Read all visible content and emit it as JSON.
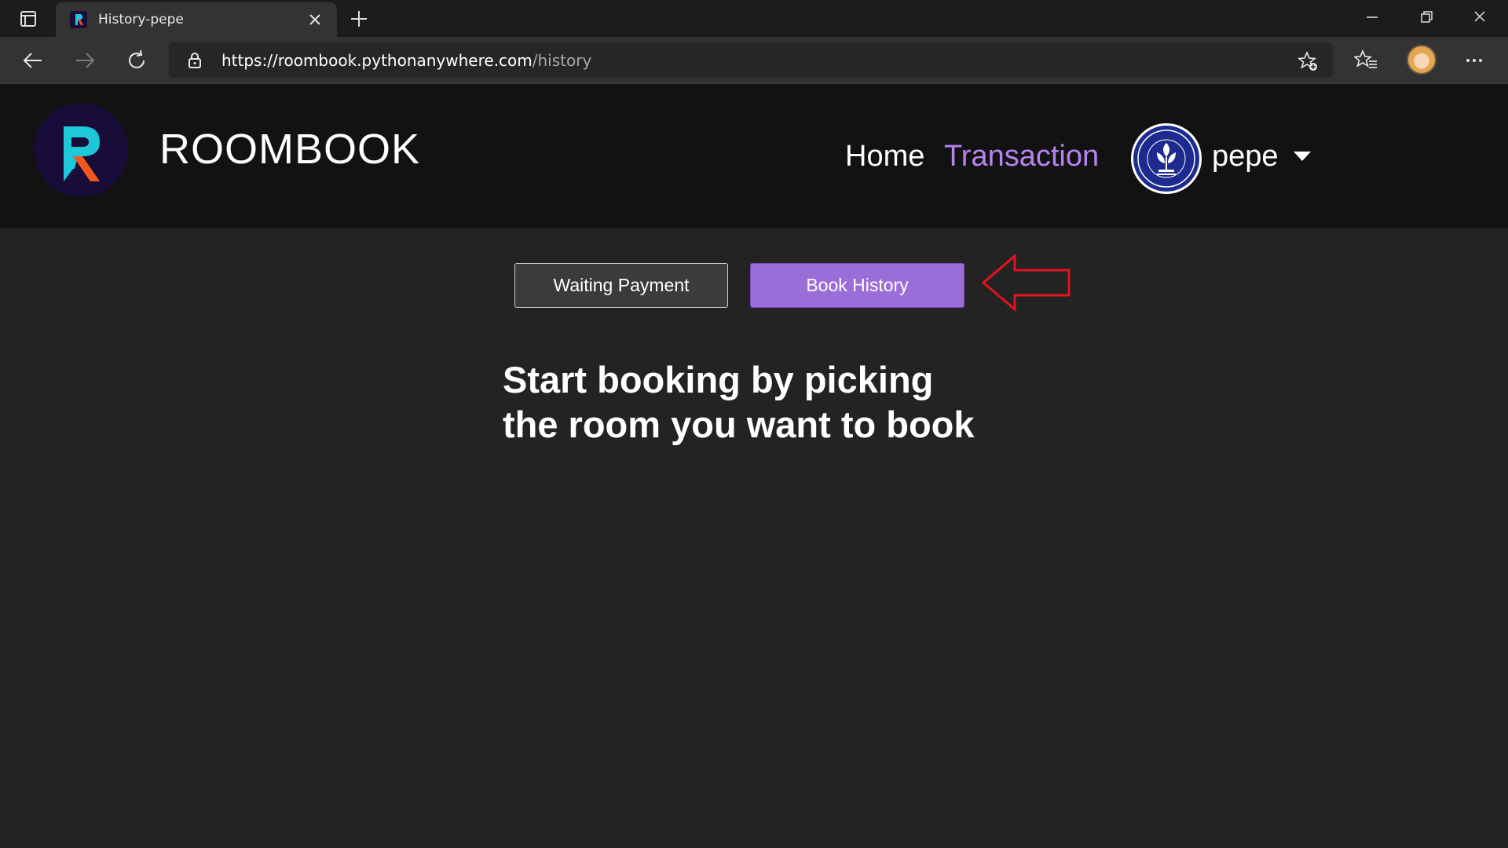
{
  "browser": {
    "tab_title": "History-pepe",
    "url_host": "https://roombook.pythonanywhere.com",
    "url_path": "/history"
  },
  "site": {
    "brand": "ROOMBOOK",
    "nav": {
      "home": "Home",
      "transaction": "Transaction"
    },
    "user_name": "pepe"
  },
  "tabs": {
    "waiting_payment": "Waiting Payment",
    "book_history": "Book History"
  },
  "message": {
    "line1": "Start booking by picking",
    "line2": "the room you want to book"
  },
  "colors": {
    "accent": "#9b6dd8",
    "active_nav": "#b784f0",
    "annotation_arrow": "#e0141e"
  }
}
